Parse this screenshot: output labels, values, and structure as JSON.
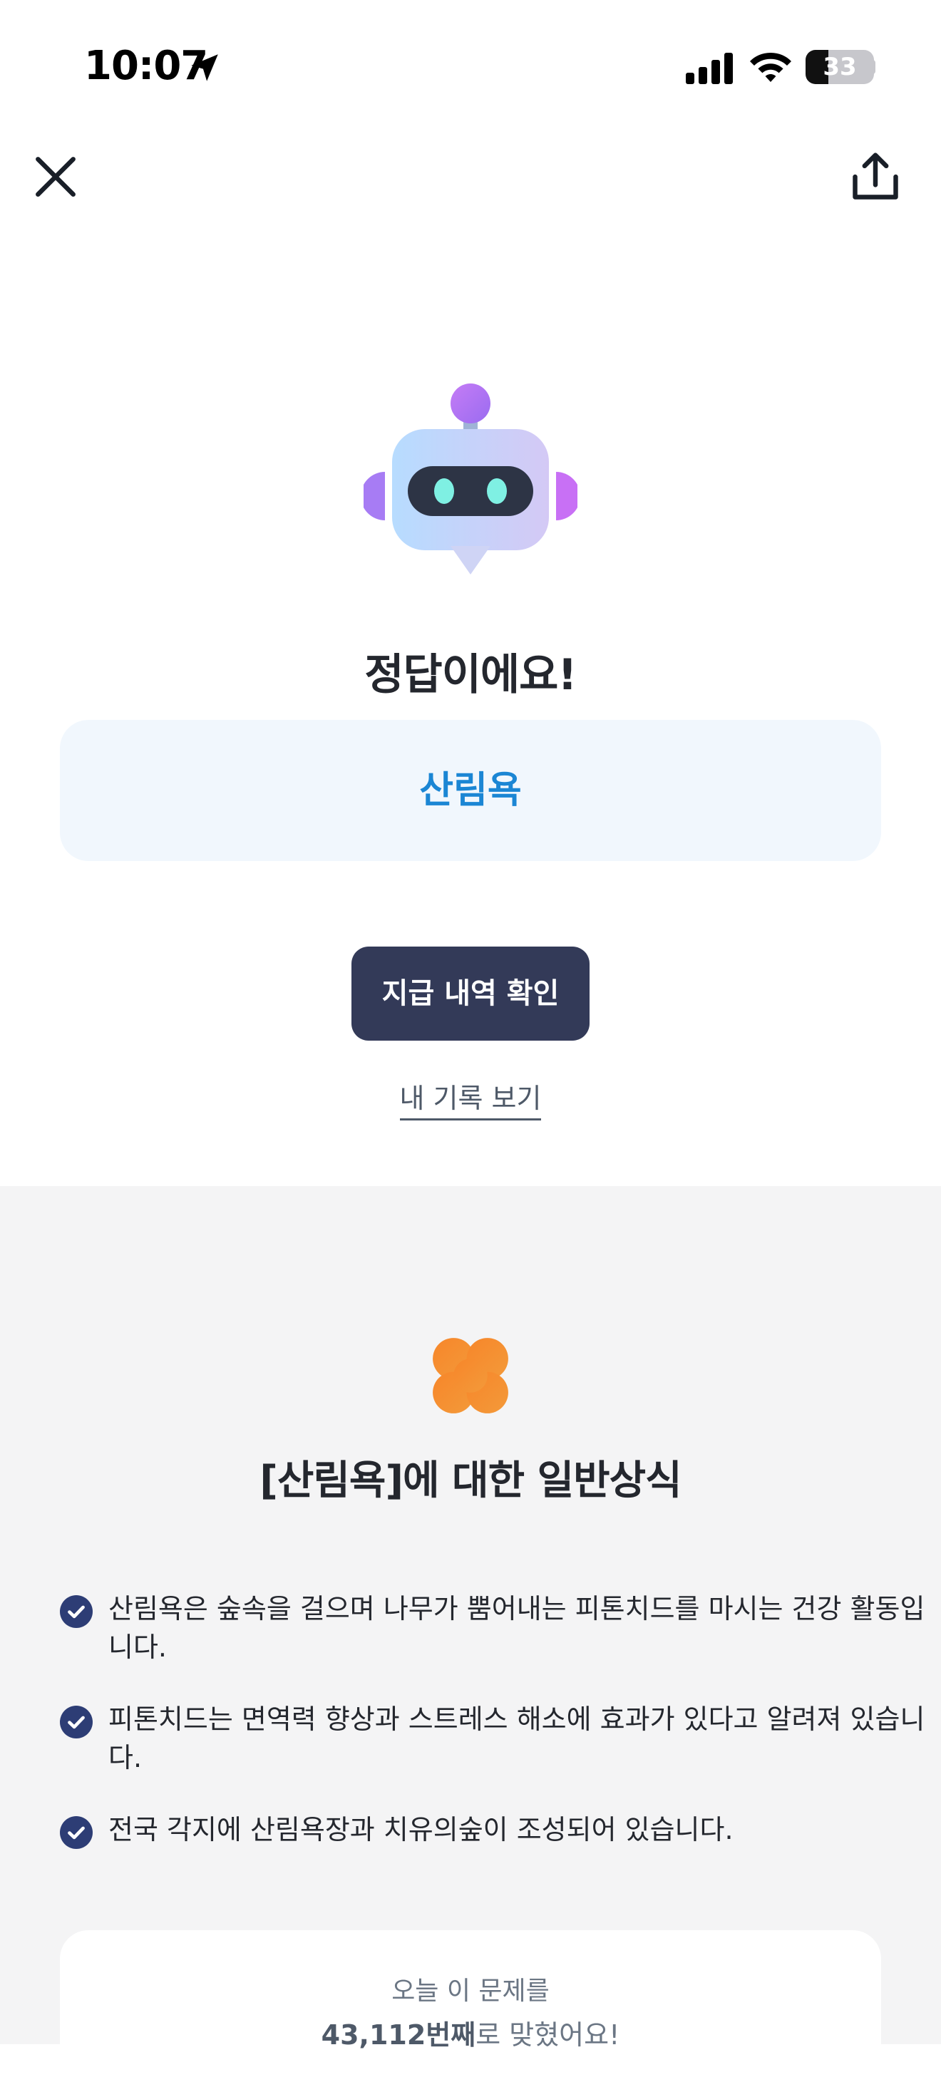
{
  "status_bar": {
    "time": "10:07",
    "battery_level": "33",
    "battery_fraction": 0.33
  },
  "icons": {
    "close": "close-icon",
    "share": "share-icon",
    "location": "location-arrow-icon",
    "signal": "cellular-signal-icon",
    "wifi": "wifi-icon",
    "robot": "robot-mascot-icon",
    "clover": "clover-icon",
    "check": "check-circle-icon"
  },
  "result": {
    "title": "정답이에요!",
    "answer": "산림욕"
  },
  "actions": {
    "primary_label": "지급 내역 확인",
    "record_link": "내 기록 보기"
  },
  "knowledge": {
    "title": "[산림욕]에 대한 일반상식",
    "facts": [
      "산림욕은 숲속을 걸으며 나무가 뿜어내는 피톤치드를 마시는 건강 활동입니다.",
      "피톤치드는 면역력 향상과 스트레스 해소에 효과가 있다고 알려져 있습니다.",
      "전국 각지에 산림욕장과 치유의숲이 조성되어 있습니다."
    ]
  },
  "stats": {
    "line1": "오늘 이 문제를",
    "count": "43,112번째",
    "suffix": "로 맞혔어요!"
  },
  "colors": {
    "accent_blue": "#1b86d4",
    "button_navy": "#333a58",
    "check_navy": "#2d3d75",
    "clover_orange": "#f5842a"
  }
}
